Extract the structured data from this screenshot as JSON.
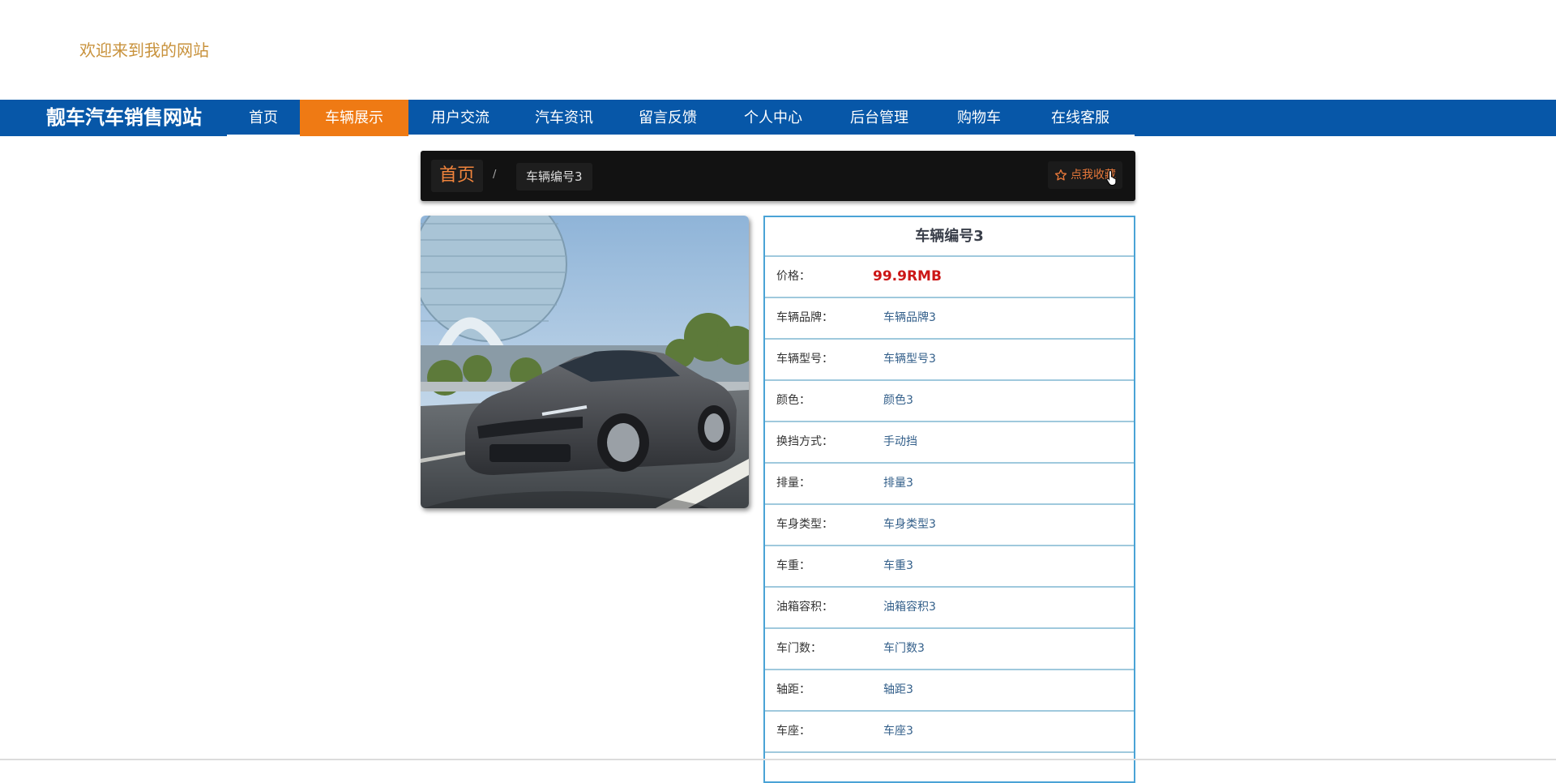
{
  "header": {
    "welcome": "欢迎来到我的网站"
  },
  "navbar": {
    "brand": "靓车汽车销售网站",
    "items": [
      {
        "label": "首页",
        "active": false
      },
      {
        "label": "车辆展示",
        "active": true
      },
      {
        "label": "用户交流",
        "active": false
      },
      {
        "label": "汽车资讯",
        "active": false
      },
      {
        "label": "留言反馈",
        "active": false
      },
      {
        "label": "个人中心",
        "active": false
      },
      {
        "label": "后台管理",
        "active": false
      },
      {
        "label": "购物车",
        "active": false
      },
      {
        "label": "在线客服",
        "active": false
      }
    ]
  },
  "breadcrumb": {
    "home": "首页",
    "separator": "/",
    "current": "车辆编号3",
    "favorite": "点我收藏"
  },
  "details": {
    "title": "车辆编号3",
    "price_label": "价格：",
    "price_value": "99.9RMB",
    "rows": [
      {
        "label": "车辆品牌：",
        "value": "车辆品牌3"
      },
      {
        "label": "车辆型号：",
        "value": "车辆型号3"
      },
      {
        "label": "颜色：",
        "value": "颜色3"
      },
      {
        "label": "换挡方式：",
        "value": "手动挡"
      },
      {
        "label": "排量：",
        "value": "排量3"
      },
      {
        "label": "车身类型：",
        "value": "车身类型3"
      },
      {
        "label": "车重：",
        "value": "车重3"
      },
      {
        "label": "油箱容积：",
        "value": "油箱容积3"
      },
      {
        "label": "车门数：",
        "value": "车门数3"
      },
      {
        "label": "轴距：",
        "value": "轴距3"
      },
      {
        "label": "车座：",
        "value": "车座3"
      }
    ]
  },
  "colors": {
    "nav_bg": "#0757a8",
    "nav_active": "#ef7a14",
    "price": "#cc1616",
    "accent_border": "#4aa3d6"
  },
  "icons": {
    "favorite": "star-icon",
    "cursor": "hand-pointer-icon"
  }
}
